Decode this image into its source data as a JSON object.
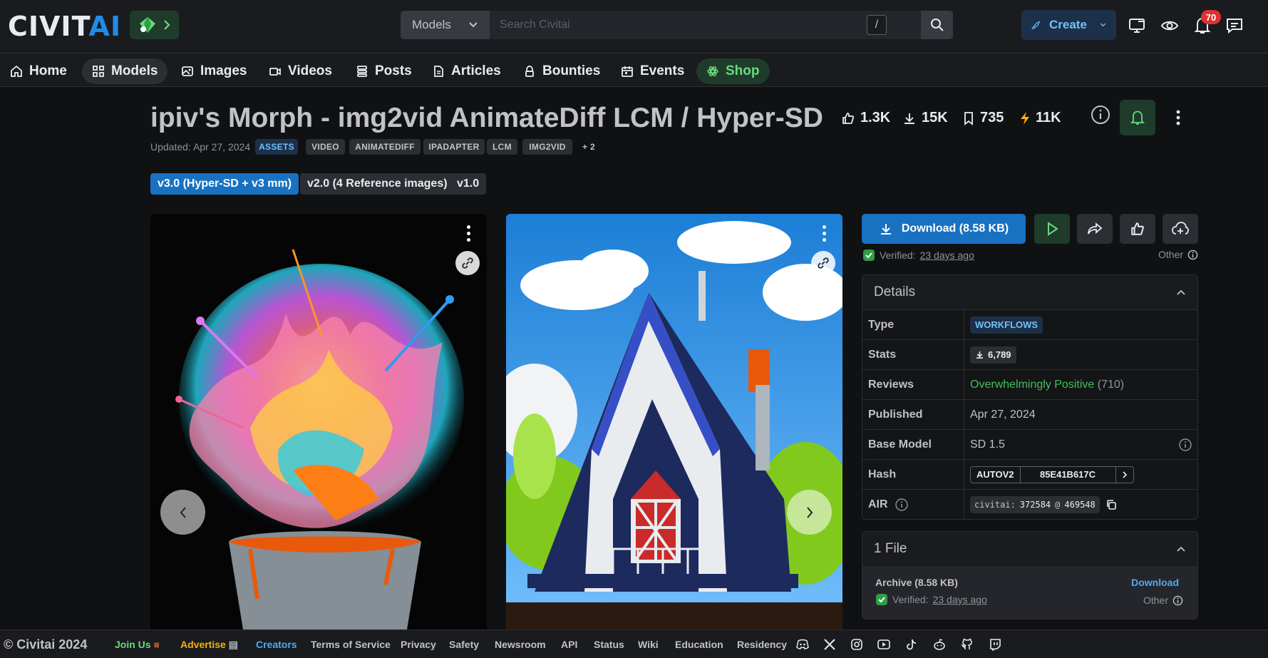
{
  "header": {
    "logo_main": "CIVIT",
    "logo_accent": "AI",
    "search": {
      "category": "Models",
      "placeholder": "Search Civitai",
      "shortcut": "/"
    },
    "create_label": "Create",
    "notification_count": "70"
  },
  "nav": {
    "items": [
      {
        "label": "Home",
        "icon": "home-icon"
      },
      {
        "label": "Models",
        "icon": "grid-icon"
      },
      {
        "label": "Images",
        "icon": "photo-icon"
      },
      {
        "label": "Videos",
        "icon": "video-icon"
      },
      {
        "label": "Posts",
        "icon": "posts-icon"
      },
      {
        "label": "Articles",
        "icon": "article-icon"
      },
      {
        "label": "Bounties",
        "icon": "bounty-icon"
      },
      {
        "label": "Events",
        "icon": "calendar-icon"
      },
      {
        "label": "Shop",
        "icon": "shop-icon"
      }
    ],
    "active": "Models"
  },
  "model": {
    "title": "ipiv's Morph - img2vid AnimateDiff LCM / Hyper-SD",
    "stats": {
      "likes": "1.3K",
      "downloads": "15K",
      "bookmarks": "735",
      "buzz": "11K"
    },
    "updated": "Updated: Apr 27, 2024",
    "tags": [
      "ASSETS",
      "VIDEO",
      "ANIMATEDIFF",
      "IPADAPTER",
      "LCM",
      "IMG2VID",
      "+ 2"
    ],
    "versions": [
      "v3.0 (Hyper-SD + v3 mm)",
      "v2.0 (4 Reference images)",
      "v1.0"
    ],
    "active_version": "v3.0 (Hyper-SD + v3 mm)"
  },
  "sidebar": {
    "download_label": "Download (8.58 KB)",
    "verified_prefix": "Verified:",
    "verified_when": "23 days ago",
    "other_label": "Other",
    "details": {
      "title": "Details",
      "type_label": "Type",
      "type_value": "WORKFLOWS",
      "stats_label": "Stats",
      "stats_value": "6,789",
      "reviews_label": "Reviews",
      "reviews_value": "Overwhelmingly Positive",
      "reviews_count": "(710)",
      "published_label": "Published",
      "published_value": "Apr 27, 2024",
      "base_label": "Base Model",
      "base_value": "SD 1.5",
      "hash_label": "Hash",
      "hash_type": "AUTOV2",
      "hash_value": "85E41B617C",
      "air_label": "AIR",
      "air_prefix": "civitai:",
      "air_model": "372584",
      "air_at": "@",
      "air_version": "469548"
    },
    "files": {
      "title": "1 File",
      "name": "Archive (8.58 KB)",
      "download": "Download"
    }
  },
  "footer": {
    "copyright": "© Civitai 2024",
    "links": [
      "Join Us",
      "Advertise",
      "Creators",
      "Terms of Service",
      "Privacy",
      "Safety",
      "Newsroom",
      "API",
      "Status",
      "Wiki",
      "Education",
      "Residency"
    ]
  },
  "colors": {
    "accent": "#1971c2",
    "positive": "#40c057",
    "green_shop": "#69db7c",
    "badge": "#e03131"
  }
}
